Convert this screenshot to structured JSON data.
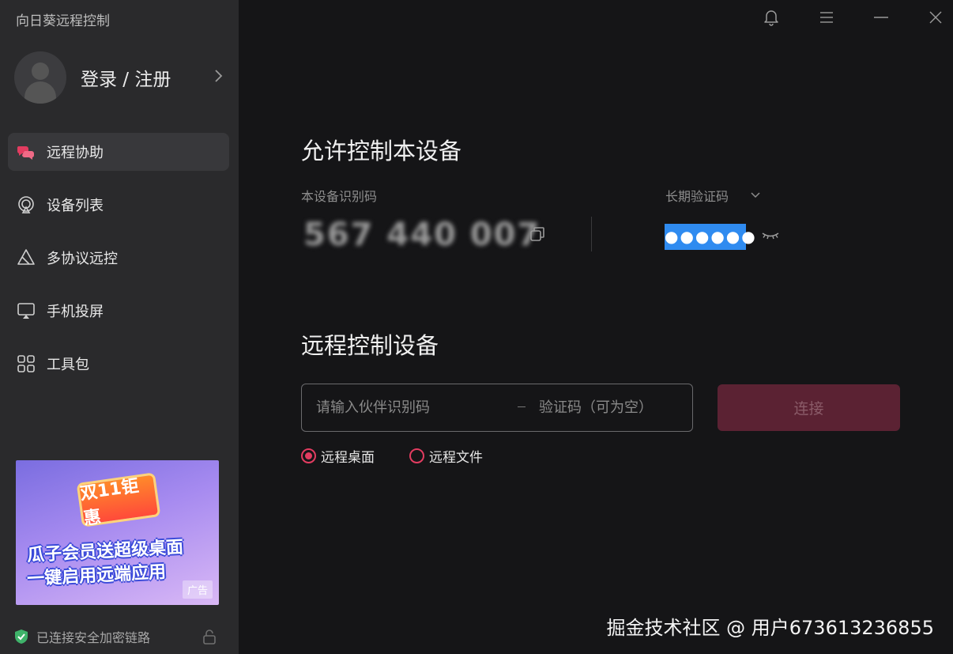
{
  "app": {
    "title": "向日葵远程控制"
  },
  "user": {
    "login_label": "登录 / 注册"
  },
  "sidebar": {
    "items": [
      {
        "label": "远程协助",
        "icon": "remote-assist-icon",
        "active": true
      },
      {
        "label": "设备列表",
        "icon": "device-list-icon",
        "active": false
      },
      {
        "label": "多协议远控",
        "icon": "multi-protocol-icon",
        "active": false
      },
      {
        "label": "手机投屏",
        "icon": "screen-cast-icon",
        "active": false
      },
      {
        "label": "工具包",
        "icon": "toolbox-icon",
        "active": false
      }
    ]
  },
  "ad": {
    "badge": "双11钜惠",
    "line1": "瓜子会员送超级桌面",
    "line2": "一键启用远端应用",
    "tag": "广告"
  },
  "status": {
    "secure_label": "已连接安全加密链路"
  },
  "allow": {
    "title": "允许控制本设备",
    "device_id_label": "本设备识别码",
    "device_id": "567 440 007",
    "password_label": "长期验证码",
    "password_mask": "●●●●●●"
  },
  "remote": {
    "title": "远程控制设备",
    "partner_placeholder": "请输入伙伴识别码",
    "code_placeholder": "验证码（可为空）",
    "connect_label": "连接",
    "modes": [
      {
        "label": "远程桌面",
        "checked": true
      },
      {
        "label": "远程文件",
        "checked": false
      }
    ]
  },
  "watermark": "掘金技术社区 @ 用户673613236855",
  "colors": {
    "accent": "#e23c60",
    "selection": "#2f8bf0",
    "sidebar_bg": "#2a2a2c",
    "main_bg": "#151517"
  }
}
